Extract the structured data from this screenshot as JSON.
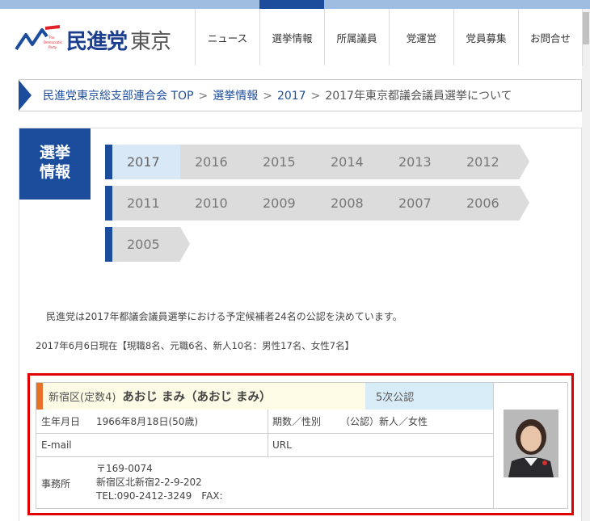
{
  "header": {
    "logo_main": "民進党",
    "logo_sub": "東京",
    "logo_mark_text": "The Democratic Party",
    "nav": [
      {
        "label": "ニュース"
      },
      {
        "label": "選挙情報"
      },
      {
        "label": "所属議員"
      },
      {
        "label": "党運営"
      },
      {
        "label": "党員募集"
      },
      {
        "label": "お問合せ"
      }
    ],
    "active_nav": "選挙情報"
  },
  "breadcrumb": {
    "items": [
      "民進党東京総支部連合会 TOP",
      "選挙情報",
      "2017"
    ],
    "current": "2017年東京都議会議員選挙について",
    "separator": ">"
  },
  "section": {
    "label_line1": "選挙",
    "label_line2": "情報"
  },
  "years": {
    "row1": [
      "2017",
      "2016",
      "2015",
      "2014",
      "2013",
      "2012"
    ],
    "row2": [
      "2011",
      "2010",
      "2009",
      "2008",
      "2007",
      "2006"
    ],
    "row3": [
      "2005"
    ],
    "active": "2017"
  },
  "intro": "民進党は2017年都議会議員選挙における予定候補者24名の公認を決めています。",
  "status": "2017年6月6日現在【現職8名、元職6名、新人10名：男性17名、女性7名】",
  "candidate": {
    "district": "新宿区(定数4)",
    "name": "あおじ まみ（あおじ まみ）",
    "round": "5次公認",
    "birth_label": "生年月日",
    "birth_value": "1966年8月18日(50歳)",
    "term_label": "期数／性別",
    "term_value": "（公認）新人／女性",
    "email_label": "E-mail",
    "url_label": "URL",
    "office_label": "事務所",
    "postal": "〒169-0074",
    "address": "新宿区北新宿2-2-9-202",
    "tel": "TEL:090-2412-3249　FAX:"
  },
  "colors": {
    "brand_blue": "#1c4d9d",
    "highlight_red": "#e00000",
    "accent_orange": "#e8712a"
  }
}
